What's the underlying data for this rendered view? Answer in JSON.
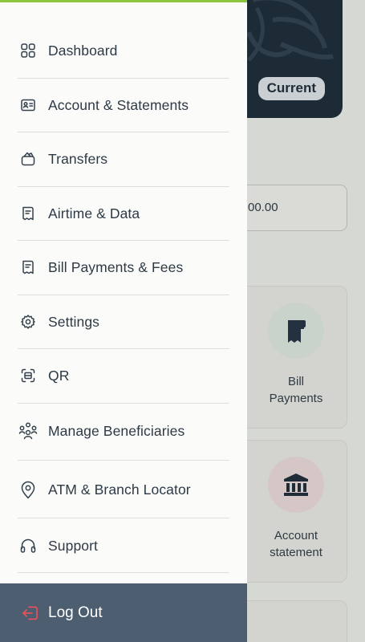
{
  "background": {
    "account_badge": "Current",
    "balance_partial": "00.00",
    "tiles": [
      {
        "label_line1": "Bill",
        "label_line2": "Payments",
        "icon": "receipt-icon"
      },
      {
        "label_line1": "Account",
        "label_line2": "statement",
        "icon": "bank-icon"
      }
    ]
  },
  "drawer": {
    "accent_color": "#8cc63f",
    "items": [
      {
        "label": "Dashboard",
        "icon": "grid-icon"
      },
      {
        "label": "Account & Statements",
        "icon": "id-card-icon"
      },
      {
        "label": "Transfers",
        "icon": "wallet-icon"
      },
      {
        "label": "Airtime & Data",
        "icon": "receipt-icon"
      },
      {
        "label": "Bill Payments & Fees",
        "icon": "receipt-icon"
      },
      {
        "label": "Settings",
        "icon": "gear-icon"
      },
      {
        "label": "QR",
        "icon": "qr-scan-icon"
      },
      {
        "label": "Manage Beneficiaries",
        "icon": "people-icon"
      },
      {
        "label": "ATM & Branch Locator",
        "icon": "location-pin-icon"
      },
      {
        "label": "Support",
        "icon": "headphones-icon"
      }
    ],
    "logout": {
      "label": "Log Out",
      "icon": "logout-icon",
      "bar_color": "#4c5e70",
      "icon_color": "#e8505b"
    }
  }
}
